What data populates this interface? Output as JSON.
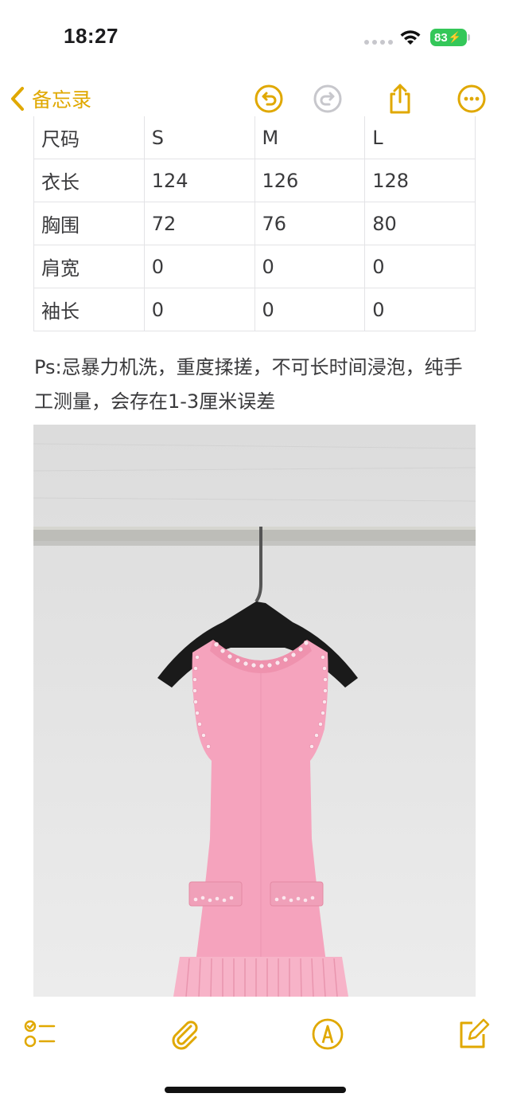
{
  "status": {
    "time": "18:27",
    "battery": "83"
  },
  "nav": {
    "back_label": "备忘录",
    "icons": [
      "undo-icon",
      "redo-icon",
      "share-icon",
      "more-icon"
    ]
  },
  "size_table": {
    "header": [
      "尺码",
      "S",
      "M",
      "L"
    ],
    "rows": [
      [
        "衣长",
        "124",
        "126",
        "128"
      ],
      [
        "胸围",
        "72",
        "76",
        "80"
      ],
      [
        "肩宽",
        "0",
        "0",
        "0"
      ],
      [
        "袖长",
        "0",
        "0",
        "0"
      ]
    ]
  },
  "note": {
    "text": "Ps:忌暴力机洗，重度揉搓，不可长时间浸泡，纯手工测量，会存在1-3厘米误差"
  },
  "photo": {
    "subject": "pink sleeveless knit dress with pearl trim on hanger"
  },
  "toolbar": {
    "icons": [
      "checklist-icon",
      "attachment-icon",
      "markup-icon",
      "compose-icon"
    ]
  },
  "colors": {
    "accent": "#e0a800",
    "dress": "#f5a3bd",
    "wall": "#e6e6e6"
  }
}
